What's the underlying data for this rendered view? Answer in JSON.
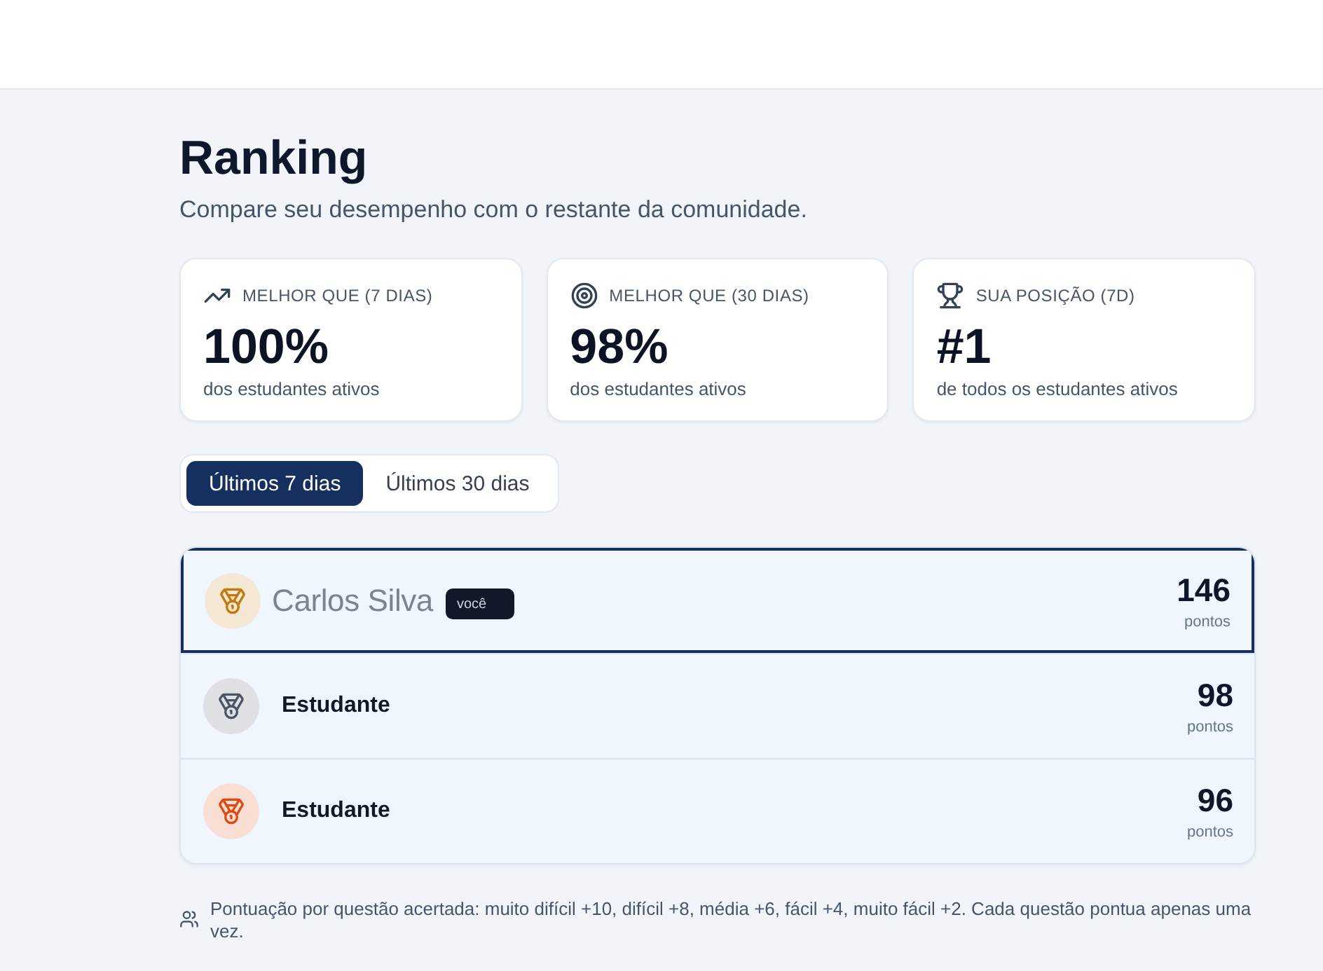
{
  "page": {
    "title": "Ranking",
    "subtitle": "Compare seu desempenho com o restante da comunidade."
  },
  "stats": [
    {
      "label": "MELHOR QUE (7 DIAS)",
      "value": "100%",
      "caption": "dos estudantes ativos"
    },
    {
      "label": "MELHOR QUE (30 DIAS)",
      "value": "98%",
      "caption": "dos estudantes ativos"
    },
    {
      "label": "SUA POSIÇÃO (7D)",
      "value": "#1",
      "caption": "de todos os estudantes ativos"
    }
  ],
  "tabs": [
    {
      "label": "Últimos 7 dias",
      "selected": true
    },
    {
      "label": "Últimos 30 dias",
      "selected": false
    }
  ],
  "ranking": [
    {
      "name": "Carlos Silva",
      "color": "#c2780a",
      "highlighted": true,
      "badge": "você",
      "score": "146",
      "unit": "pontos"
    },
    {
      "name": "Estudante",
      "color": "#4b5563",
      "highlighted": false,
      "score": "98",
      "unit": "pontos"
    },
    {
      "name": "Estudante",
      "color": "#e0480f",
      "highlighted": false,
      "score": "96",
      "unit": "pontos"
    }
  ],
  "footnote": "Pontuação por questão acertada: muito difícil +10, difícil +8, média +6, fácil +4, muito fácil +2. Cada questão pontua apenas uma vez."
}
